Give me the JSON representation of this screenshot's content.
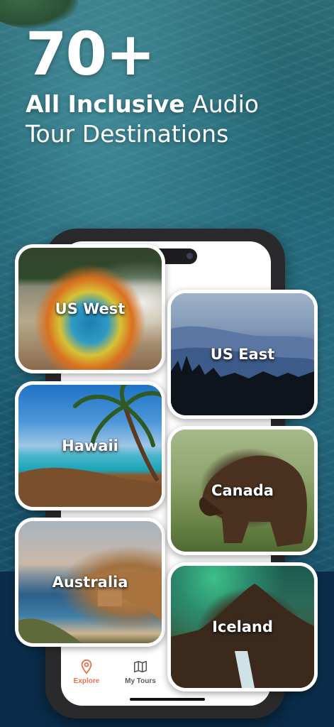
{
  "headline": {
    "number": "70+",
    "line1_bold": "All Inclusive",
    "line1_rest": " Audio",
    "line2": "Tour Destinations"
  },
  "destinations": [
    {
      "label": "US West"
    },
    {
      "label": "Hawaii"
    },
    {
      "label": "Australia"
    },
    {
      "label": "US East"
    },
    {
      "label": "Canada"
    },
    {
      "label": "Iceland"
    }
  ],
  "tab_bar": {
    "explore": {
      "label": "Explore",
      "icon": "map-pin-icon",
      "color": "#e8734a",
      "active": true
    },
    "my_tours": {
      "label": "My Tours",
      "icon": "folded-map-icon",
      "color": "#5a5a5a",
      "active": false
    }
  }
}
